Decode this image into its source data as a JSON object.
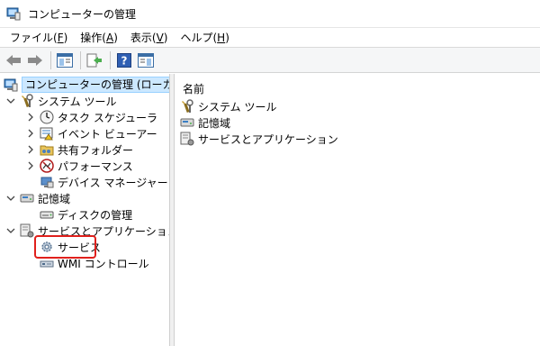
{
  "window": {
    "title": "コンピューターの管理"
  },
  "menu": [
    {
      "label": "ファイル(",
      "key": "F",
      "tail": ")"
    },
    {
      "label": "操作(",
      "key": "A",
      "tail": ")"
    },
    {
      "label": "表示(",
      "key": "V",
      "tail": ")"
    },
    {
      "label": "ヘルプ(",
      "key": "H",
      "tail": ")"
    }
  ],
  "tree": {
    "root": "コンピューターの管理 (ローカル)",
    "system_tools": "システム ツール",
    "task_scheduler": "タスク スケジューラ",
    "event_viewer": "イベント ビューアー",
    "shared_folders": "共有フォルダー",
    "performance": "パフォーマンス",
    "device_manager": "デバイス マネージャー",
    "storage": "記憶域",
    "disk_management": "ディスクの管理",
    "services_apps": "サービスとアプリケーション",
    "services": "サービス",
    "wmi_control": "WMI コントロール"
  },
  "list": {
    "column_name": "名前",
    "items": [
      "システム ツール",
      "記憶域",
      "サービスとアプリケーション"
    ]
  },
  "colors": {
    "selection": "#cce8ff",
    "highlight": "#e0201c"
  }
}
